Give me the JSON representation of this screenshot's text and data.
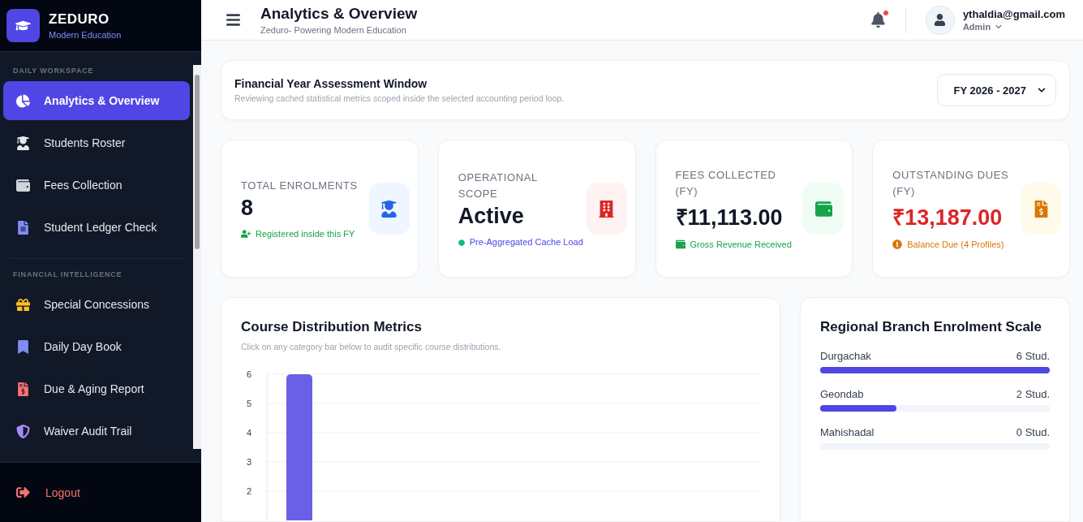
{
  "brand": {
    "name": "ZEDURO",
    "tagline": "Modern Education"
  },
  "sidebar": {
    "sections": [
      {
        "title": "DAILY WORKSPACE",
        "items": [
          {
            "label": "Analytics & Overview",
            "selected": true
          },
          {
            "label": "Students Roster",
            "selected": false
          },
          {
            "label": "Fees Collection",
            "selected": false
          },
          {
            "label": "Student Ledger Check",
            "selected": false
          }
        ]
      },
      {
        "title": "FINANCIAL INTELLIGENCE",
        "items": [
          {
            "label": "Special Concessions",
            "selected": false
          },
          {
            "label": "Daily Day Book",
            "selected": false
          },
          {
            "label": "Due & Aging Report",
            "selected": false
          },
          {
            "label": "Waiver Audit Trail",
            "selected": false
          }
        ]
      }
    ],
    "logout": "Logout"
  },
  "header": {
    "title": "Analytics & Overview",
    "subtitle": "Zeduro- Powering Modern Education",
    "notification_dot": true,
    "user": {
      "email": "ythaldia@gmail.com",
      "role": "Admin"
    }
  },
  "fy_window": {
    "title": "Financial Year Assessment Window",
    "description": "Reviewing cached statistical metrics scoped inside the selected accounting period loop.",
    "select": {
      "value": "FY 2026 - 2027"
    }
  },
  "stats": [
    {
      "label": "TOTAL ENROLMENTS",
      "value": "8",
      "note": "Registered inside this FY",
      "kind": "neutral"
    },
    {
      "label": "OPERATIONAL SCOPE",
      "value": "Active",
      "note": "Pre-Aggregated Cache Load",
      "kind": "neutral"
    },
    {
      "label": "FEES COLLECTED (FY)",
      "value": "₹11,113.00",
      "note": "Gross Revenue Received",
      "kind": "neutral"
    },
    {
      "label": "OUTSTANDING DUES (FY)",
      "value": "₹13,187.00",
      "note": "Balance Due (4 Profiles)",
      "kind": "danger"
    }
  ],
  "course_chart": {
    "title": "Course Distribution Metrics",
    "subtitle": "Click on any category bar below to audit specific course distributions.",
    "chart_data": {
      "type": "bar",
      "values": [
        6
      ],
      "yticks": [
        2,
        3,
        4,
        5,
        6
      ],
      "ylim": [
        0,
        6
      ],
      "grid": true
    }
  },
  "branches": {
    "title": "Regional Branch Enrolment Scale",
    "items": [
      {
        "name": "Durgachak",
        "count": "6 Stud.",
        "level": 1
      },
      {
        "name": "Geondab",
        "count": "2 Stud.",
        "level": 0.333
      },
      {
        "name": "Mahishadal",
        "count": "0 Stud.",
        "level": 0
      }
    ]
  }
}
